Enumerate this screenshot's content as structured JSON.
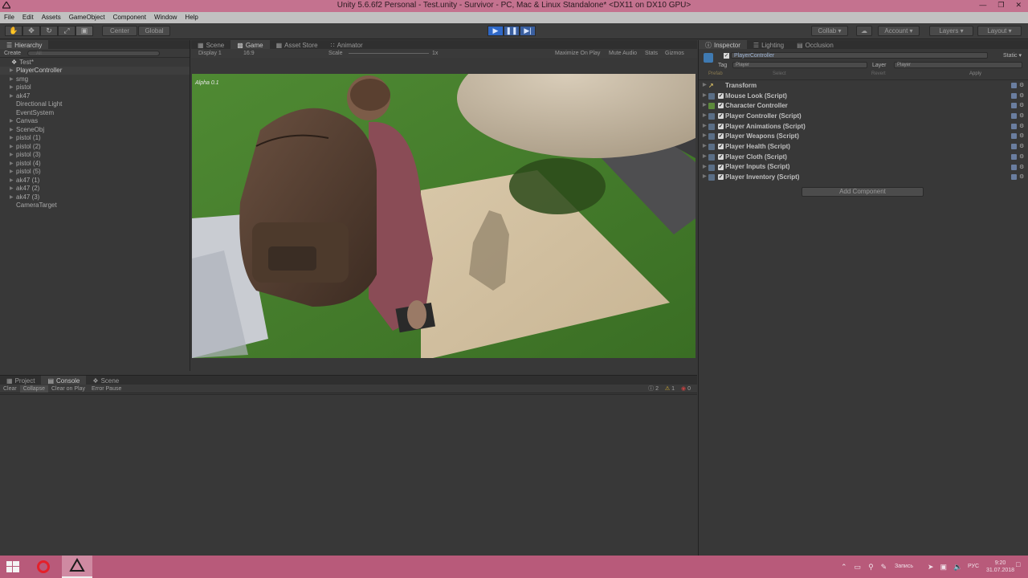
{
  "window": {
    "title": "Unity 5.6.6f2 Personal - Test.unity - Survivor - PC, Mac & Linux Standalone* <DX11 on DX10 GPU>"
  },
  "menu": [
    "File",
    "Edit",
    "Assets",
    "GameObject",
    "Component",
    "Window",
    "Help"
  ],
  "toolbar": {
    "pivot": "Center",
    "space": "Global",
    "collab": "Collab",
    "account": "Account",
    "layers": "Layers",
    "layout": "Layout"
  },
  "hierarchy": {
    "tab": "Hierarchy",
    "create": "Create",
    "search_placeholder": "All",
    "scene": "Test*",
    "items": [
      "PlayerController",
      "smg",
      "pistol",
      "ak47",
      "Directional Light",
      "EventSystem",
      "Canvas",
      "SceneObj",
      "pistol (1)",
      "pistol (2)",
      "pistol (3)",
      "pistol (4)",
      "pistol (5)",
      "ak47 (1)",
      "ak47 (2)",
      "ak47 (3)",
      "CameraTarget"
    ]
  },
  "center_tabs": [
    "Scene",
    "Game",
    "Asset Store",
    "Animator"
  ],
  "game": {
    "display": "Display 1",
    "aspect": "16:9",
    "scale_label": "Scale",
    "scale_value": "1x",
    "options": [
      "Maximize On Play",
      "Mute Audio",
      "Stats",
      "Gizmos"
    ],
    "overlay_text": "Alpha 0.1"
  },
  "bottom_tabs": [
    "Project",
    "Console",
    "Scene"
  ],
  "console": {
    "buttons": [
      "Clear",
      "Collapse",
      "Clear on Play",
      "Error Pause"
    ],
    "counts": {
      "info": "2",
      "warn": "1",
      "error": "0"
    }
  },
  "inspector": {
    "tabs": [
      "Inspector",
      "Lighting",
      "Occlusion"
    ],
    "object_name": "PlayerController",
    "static_label": "Static",
    "tag_label": "Tag",
    "tag_value": "Player",
    "layer_label": "Layer",
    "layer_value": "Player",
    "prefab": [
      "Prefab",
      "Select",
      "Revert",
      "Apply"
    ],
    "components": [
      "Transform",
      "Mouse Look (Script)",
      "Character Controller",
      "Player Controller (Script)",
      "Player Animations (Script)",
      "Player Weapons (Script)",
      "Player Health (Script)",
      "Player Cloth (Script)",
      "Player Inputs (Script)",
      "Player Inventory (Script)"
    ],
    "add_component": "Add Component"
  },
  "taskbar": {
    "lang": "РУС",
    "time": "9:20",
    "date": "31.07.2018",
    "record": "Запись"
  }
}
